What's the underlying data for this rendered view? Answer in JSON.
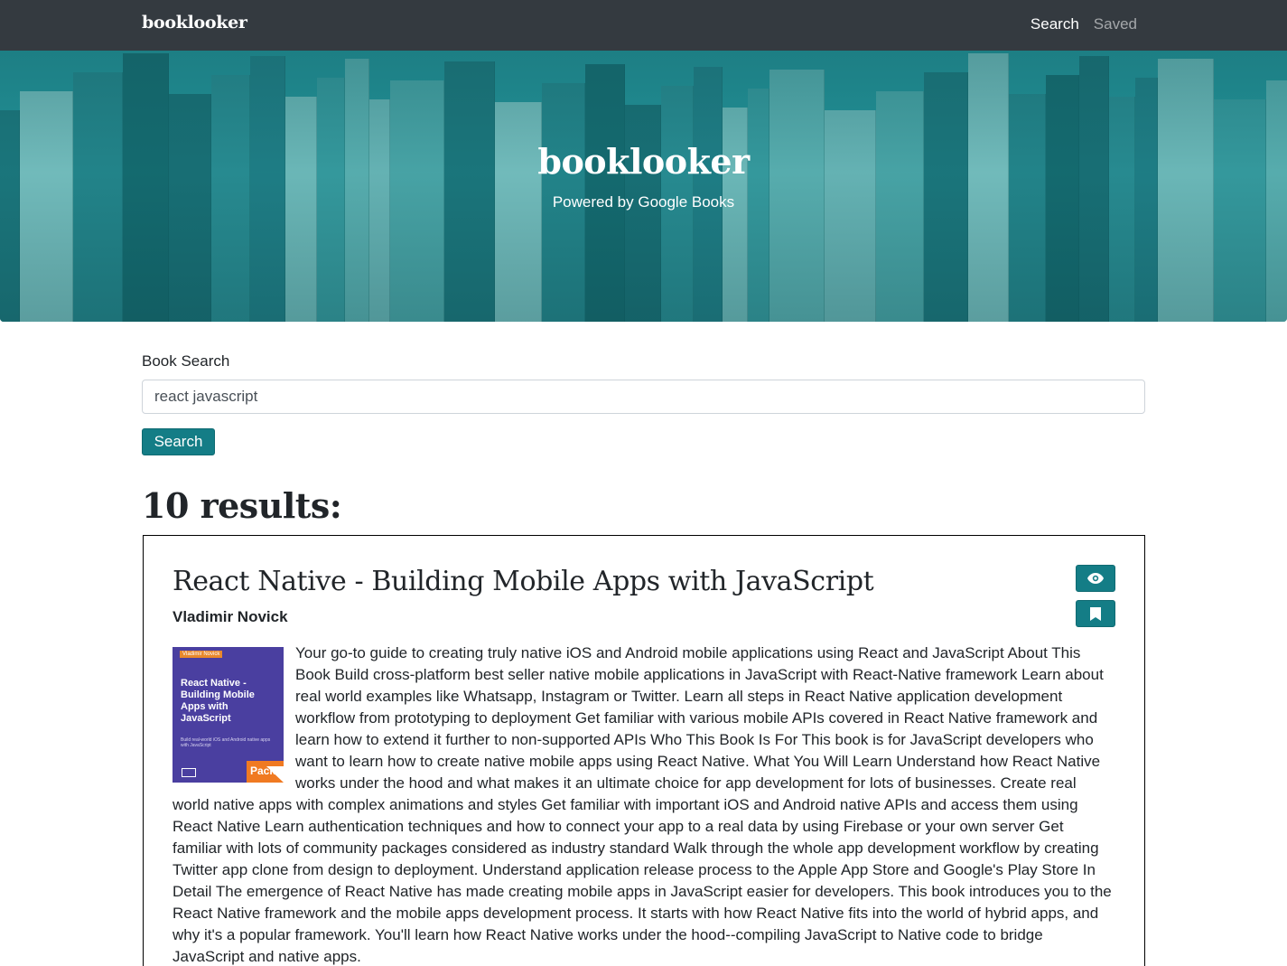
{
  "nav": {
    "brand": "booklooker",
    "links": [
      {
        "label": "Search",
        "active": true
      },
      {
        "label": "Saved",
        "active": false
      }
    ]
  },
  "hero": {
    "title": "booklooker",
    "subtitle": "Powered by Google Books"
  },
  "search": {
    "label": "Book Search",
    "value": "react javascript",
    "button_label": "Search"
  },
  "results": {
    "heading": "10 results:",
    "items": [
      {
        "title": "React Native - Building Mobile Apps with JavaScript",
        "author": "Vladimir Novick",
        "actions": [
          "eye-icon",
          "bookmark-icon"
        ],
        "cover": {
          "top_label": "Vladimir Novick",
          "title": "React Native - Building Mobile Apps with JavaScript",
          "subtitle": "Build real-world iOS and Android native apps with JavaScript",
          "publisher": "Pack"
        },
        "description": "Your go-to guide to creating truly native iOS and Android mobile applications using React and JavaScript About This Book Build cross-platform best seller native mobile applications in JavaScript with React-Native framework Learn about real world examples like Whatsapp, Instagram or Twitter. Learn all steps in React Native application development workflow from prototyping to deployment Get familiar with various mobile APIs covered in React Native framework and learn how to extend it further to non-supported APIs Who This Book Is For This book is for JavaScript developers who want to learn how to create native mobile apps using React Native. What You Will Learn Understand how React Native works under the hood and what makes it an ultimate choice for app development for lots of businesses. Create real world native apps with complex animations and styles Get familiar with important iOS and Android native APIs and access them using React Native Learn authentication techniques and how to connect your app to a real data by using Firebase or your own server Get familiar with lots of community packages considered as industry standard Walk through the whole app development workflow by creating Twitter app clone from design to deployment. Understand application release process to the Apple App Store and Google's Play Store In Detail The emergence of React Native has made creating mobile apps in JavaScript easier for developers. This book introduces you to the React Native framework and the mobile apps development process. It starts with how React Native fits into the world of hybrid apps, and why it's a popular framework. You'll learn how React Native works under the hood--compiling JavaScript to Native code to bridge JavaScript and native apps."
      }
    ]
  },
  "colors": {
    "navbar": "#343a40",
    "accent": "#147d86",
    "hero_tint": "#2e8f94"
  }
}
